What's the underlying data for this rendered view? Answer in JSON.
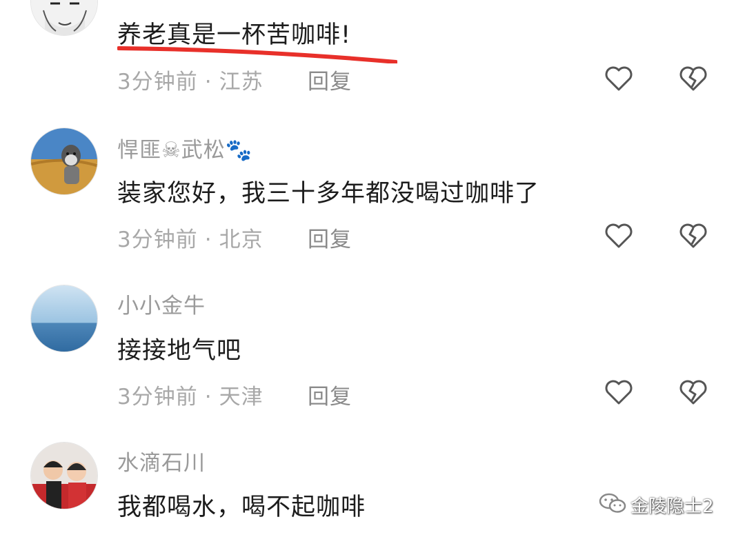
{
  "comments": [
    {
      "username": "",
      "text": "养老真是一杯苦咖啡!",
      "time": "3分钟前",
      "location": "江苏",
      "reply": "回复"
    },
    {
      "username": "悍匪☠武松🐾",
      "text": "装家您好，我三十多年都没喝过咖啡了",
      "time": "3分钟前",
      "location": "北京",
      "reply": "回复"
    },
    {
      "username": "小小金牛",
      "text": "接接地气吧",
      "time": "3分钟前",
      "location": "天津",
      "reply": "回复"
    },
    {
      "username": "水滴石川",
      "text": "我都喝水，喝不起咖啡",
      "time": "",
      "location": "",
      "reply": ""
    }
  ],
  "separator": "·",
  "icons": {
    "like": "heart-outline-icon",
    "dislike": "broken-heart-icon"
  },
  "highlight_color": "#e8302a",
  "watermark": "金陵隐士2"
}
